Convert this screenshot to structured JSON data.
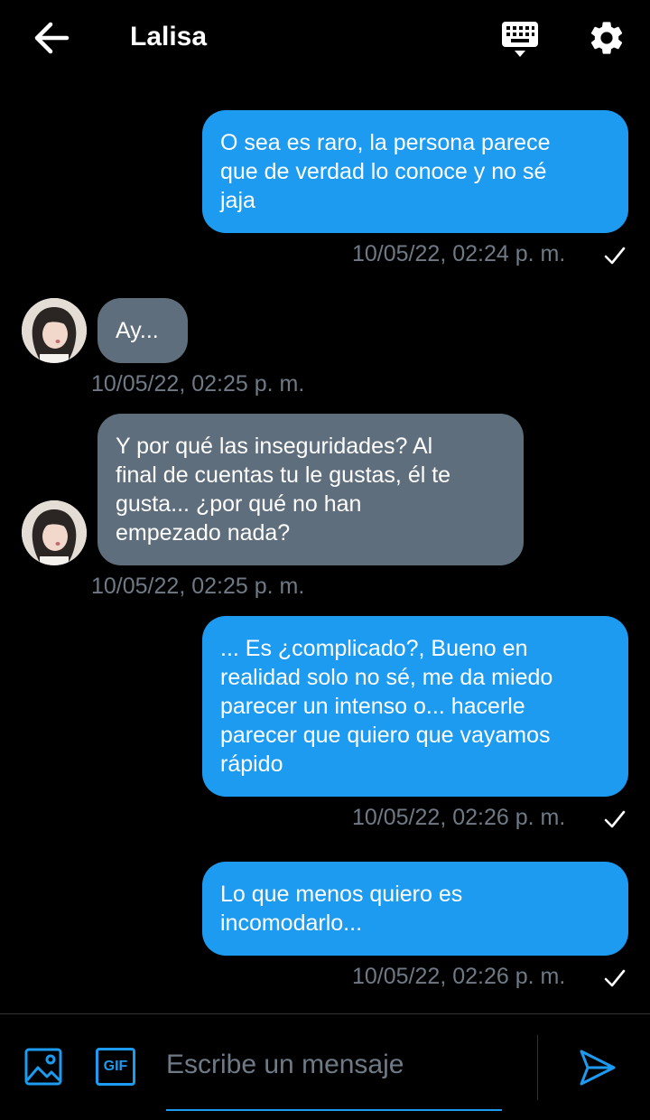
{
  "header": {
    "title": "Lalisa"
  },
  "messages": [
    {
      "text": "O sea es raro, la persona parece\nque de verdad lo conoce y  no sé\njaja",
      "time": "10/05/22, 02:24 p. m."
    },
    {
      "text": "Ay...",
      "time": "10/05/22, 02:25 p. m."
    },
    {
      "text": "Y por qué las inseguridades? Al\nfinal de cuentas tu le gustas, él te\ngusta... ¿por qué no han\nempezado nada?",
      "time": "10/05/22, 02:25 p. m."
    },
    {
      "text": "... Es ¿complicado?, Bueno en\nrealidad solo no sé, me da miedo\nparecer un intenso o... hacerle\nparecer que quiero que vayamos\nrápido",
      "time": "10/05/22, 02:26 p. m."
    },
    {
      "text": "Lo que menos quiero es\nincomodarlo...",
      "time": "10/05/22, 02:26 p. m."
    }
  ],
  "composer": {
    "placeholder": "Escribe un mensaje",
    "gif_label": "GIF"
  },
  "colors": {
    "accent": "#1d9bf0",
    "incoming_bubble": "#5f6e7c",
    "background": "#000000",
    "timestamp": "#6e7a86"
  },
  "icons": [
    "back-arrow-icon",
    "keyboard-icon",
    "gear-icon",
    "image-icon",
    "gif-icon",
    "send-icon",
    "check-icon"
  ]
}
